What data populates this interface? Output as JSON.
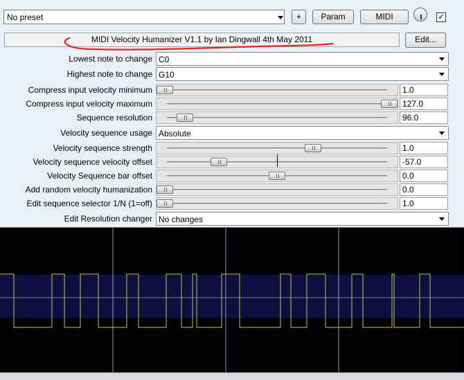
{
  "toolbar": {
    "preset_value": "No preset",
    "plus_label": "+",
    "param_label": "Param",
    "midi_label": "MIDI",
    "checkbox_mark": "✓"
  },
  "header": {
    "title": "MIDI Velocity Humanizer V1.1 by Ian Dingwall 4th May 2011",
    "edit_label": "Edit..."
  },
  "params": {
    "lowest_note": {
      "label": "Lowest note to change",
      "value": "C0"
    },
    "highest_note": {
      "label": "Highest note to change",
      "value": "G10"
    },
    "compress_min": {
      "label": "Compress input velocity minimum",
      "value": "1.0",
      "level": 0.0
    },
    "compress_max": {
      "label": "Compress input velocity maximum",
      "value": "127.0",
      "level": 1.0
    },
    "seq_res": {
      "label": "Sequence resolution",
      "value": "96.0",
      "level": 0.09
    },
    "seq_usage": {
      "label": "Velocity sequence usage",
      "value": "Absolute"
    },
    "seq_strength": {
      "label": "Velocity sequence strength",
      "value": "1.0",
      "level": 0.66
    },
    "seq_vel_offset": {
      "label": "Velocity sequence velocity offset",
      "value": "-57.0",
      "level": 0.24
    },
    "seq_bar_offset": {
      "label": "Velocity Sequence bar offset",
      "value": "0.0",
      "level": 0.5
    },
    "random_humanize": {
      "label": "Add random velocity humanization",
      "value": "0.0",
      "level": 0.0
    },
    "edit_selector": {
      "label": "Edit sequence selector 1/N (1=off)",
      "value": "1.0",
      "level": 0.0
    },
    "edit_res": {
      "label": "Edit Resolution changer",
      "value": "No changes"
    }
  },
  "colors": {
    "graph_bg": "#000000",
    "graph_grid": "#1a1a6e",
    "graph_line": "#c8c84a",
    "graph_divider": "#9a9a9a",
    "annotation": "#e8231e"
  }
}
